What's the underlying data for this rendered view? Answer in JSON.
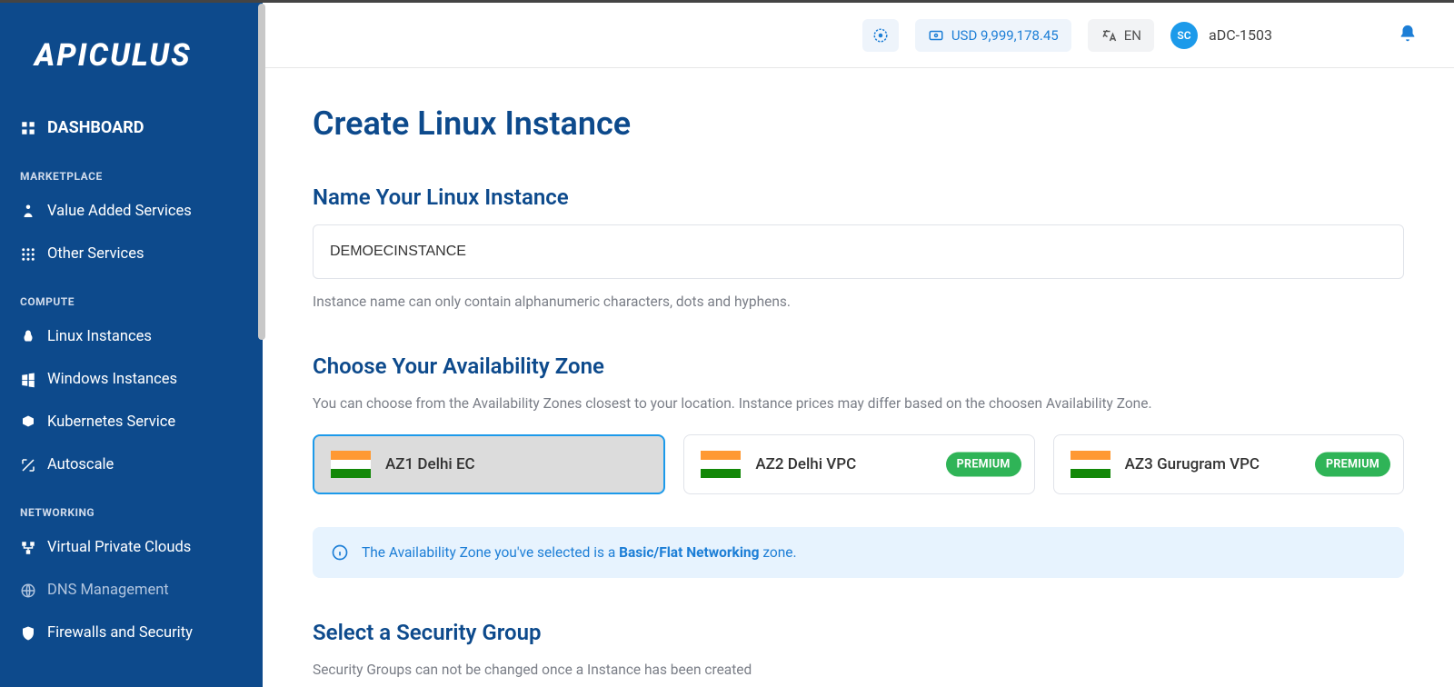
{
  "brand": "APICULUS",
  "topbar": {
    "balance": "USD 9,999,178.45",
    "language": "EN",
    "avatar_initials": "SC",
    "username": "aDC-1503"
  },
  "sidebar": {
    "dashboard": "DASHBOARD",
    "sections": {
      "marketplace": "MARKETPLACE",
      "compute": "COMPUTE",
      "networking": "NETWORKING"
    },
    "items": {
      "value_added": "Value Added Services",
      "other_services": "Other Services",
      "linux": "Linux Instances",
      "windows": "Windows Instances",
      "kubernetes": "Kubernetes Service",
      "autoscale": "Autoscale",
      "vpc": "Virtual Private Clouds",
      "dns": "DNS Management",
      "firewalls": "Firewalls and Security"
    }
  },
  "page": {
    "title": "Create Linux Instance",
    "name_section": {
      "heading": "Name Your Linux Instance",
      "value": "DEMOECINSTANCE",
      "hint": "Instance name can only contain alphanumeric characters, dots and hyphens."
    },
    "az_section": {
      "heading": "Choose Your Availability Zone",
      "hint": "You can choose from the Availability Zones closest to your location. Instance prices may differ based on the choosen Availability Zone.",
      "zones": [
        {
          "label": "AZ1 Delhi EC",
          "premium": false,
          "selected": true
        },
        {
          "label": "AZ2 Delhi VPC",
          "premium": true,
          "selected": false
        },
        {
          "label": "AZ3 Gurugram VPC",
          "premium": true,
          "selected": false
        }
      ],
      "premium_badge": "PREMIUM",
      "info_prefix": "The Availability Zone you've selected is a ",
      "info_bold": "Basic/Flat Networking",
      "info_suffix": " zone."
    },
    "sg_section": {
      "heading": "Select a Security Group",
      "hint": "Security Groups can not be changed once a Instance has been created"
    }
  }
}
